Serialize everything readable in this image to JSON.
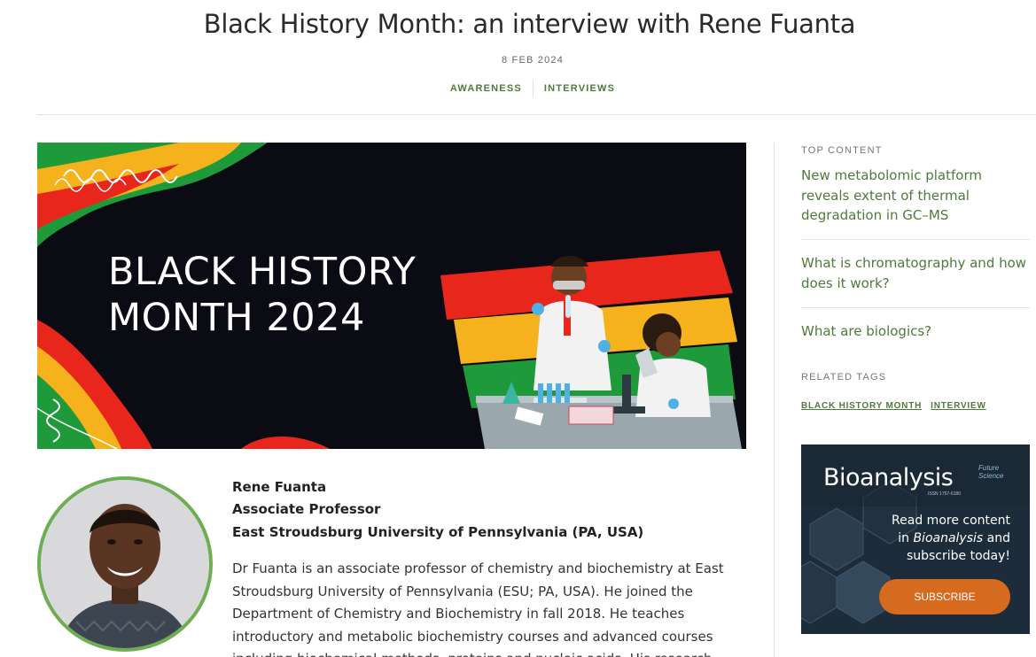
{
  "article": {
    "title": "Black History Month: an interview with Rene Fuanta",
    "date": "8 FEB 2024",
    "categories": [
      "AWARENESS",
      "INTERVIEWS"
    ]
  },
  "hero": {
    "line1": "BLACK HISTORY",
    "line2": "MONTH 2024",
    "colors": {
      "background": "#0b0b14",
      "red": "#e8261c",
      "yellow": "#f5b21d",
      "green": "#1f9a3a"
    }
  },
  "bio": {
    "name": "Rene Fuanta",
    "role": "Associate Professor",
    "institution": "East Stroudsburg University of Pennsylvania (PA, USA)",
    "lines": [
      "Dr Fuanta is an associate professor of chemistry and biochemistry at East",
      "Stroudsburg University of Pennsylvania (ESU; PA, USA). He joined the",
      "Department of Chemistry and Biochemistry in fall 2018. He teaches",
      "introductory and metabolic biochemistry courses and advanced courses",
      "including biochemical methods, proteins and nucleic acids. His research"
    ]
  },
  "sidebar": {
    "top_content_heading": "TOP CONTENT",
    "links": [
      {
        "lines": [
          "New metabolomic platform",
          "reveals extent of thermal",
          "degradation in GC–MS"
        ]
      },
      {
        "lines": [
          "What is chromatography and how",
          "does it work?"
        ]
      },
      {
        "lines": [
          "What are biologics?"
        ]
      }
    ],
    "related_tags_heading": "RELATED TAGS",
    "tags": [
      "BLACK HISTORY MONTH",
      "INTERVIEW"
    ]
  },
  "ad": {
    "logo": "Bioanalysis",
    "issn": "ISSN 1757-6180",
    "publisher_line1": "Future",
    "publisher_line2": "Science",
    "copy_line1": "Read more content",
    "copy_line2_prefix": "in ",
    "copy_line2_italic": "Bioanalysis",
    "copy_line2_suffix": " and",
    "copy_line3": "subscribe today!",
    "button": "SUBSCRIBE"
  },
  "theme": {
    "link_green": "#4e7a3a",
    "avatar_ring": "#6cae50",
    "ad_button": "#d66a1f"
  }
}
